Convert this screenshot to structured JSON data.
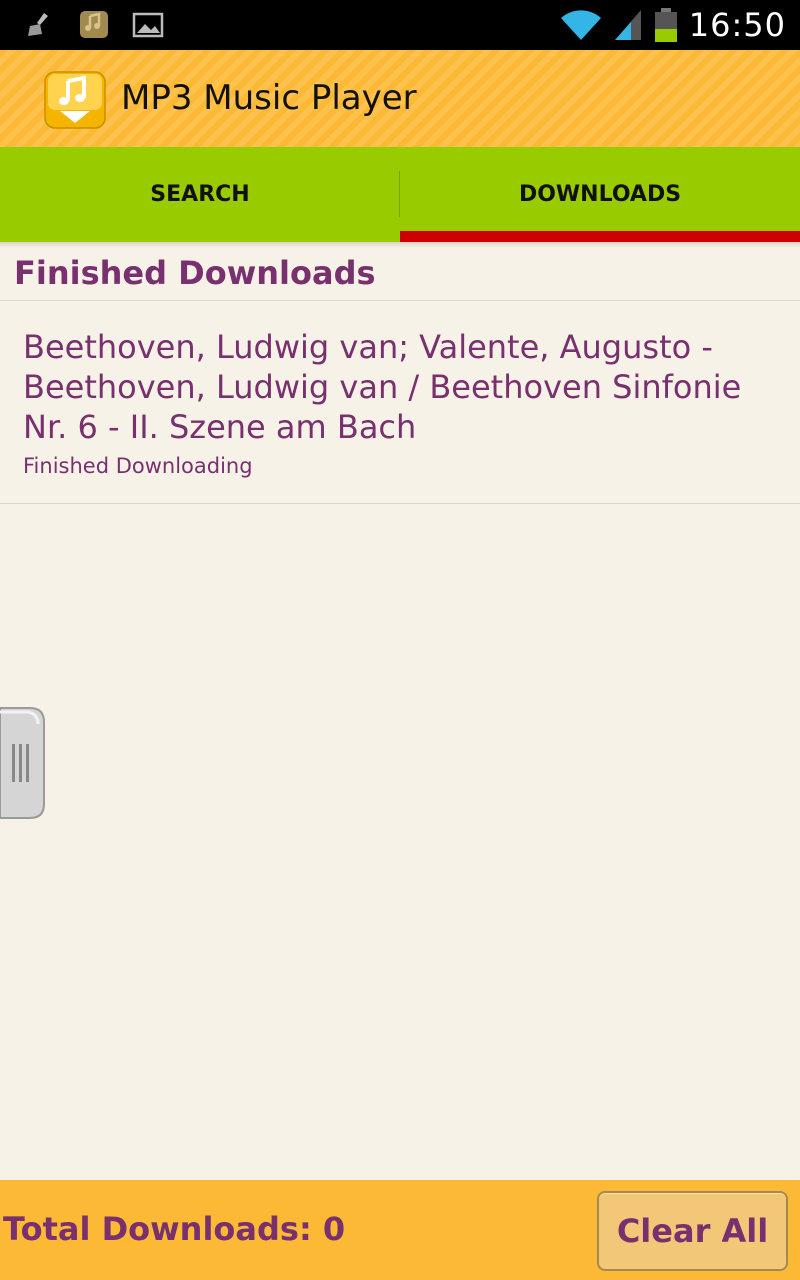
{
  "status_bar": {
    "time": "16:50",
    "icons": [
      "broom-icon",
      "music-download-icon",
      "image-icon",
      "wifi-icon",
      "signal-icon",
      "battery-icon"
    ]
  },
  "app_bar": {
    "title": "MP3 Music Player",
    "logo_icon": "music-note-download-icon"
  },
  "tabs": [
    {
      "label": "SEARCH",
      "active": false
    },
    {
      "label": "DOWNLOADS",
      "active": true
    }
  ],
  "section": {
    "title": "Finished Downloads"
  },
  "downloads": [
    {
      "title": "Beethoven, Ludwig van; Valente, Augusto - Beethoven, Ludwig van / Beethoven Sinfonie Nr. 6 - II. Szene am Bach",
      "status": "Finished Downloading"
    }
  ],
  "footer": {
    "total_label": "Total Downloads: 0",
    "clear_button": "Clear All"
  },
  "colors": {
    "accent_orange": "#fbb935",
    "tab_green": "#99cc00",
    "indicator_red": "#cc0000",
    "text_purple": "#78306e",
    "background": "#f7f2e7"
  }
}
